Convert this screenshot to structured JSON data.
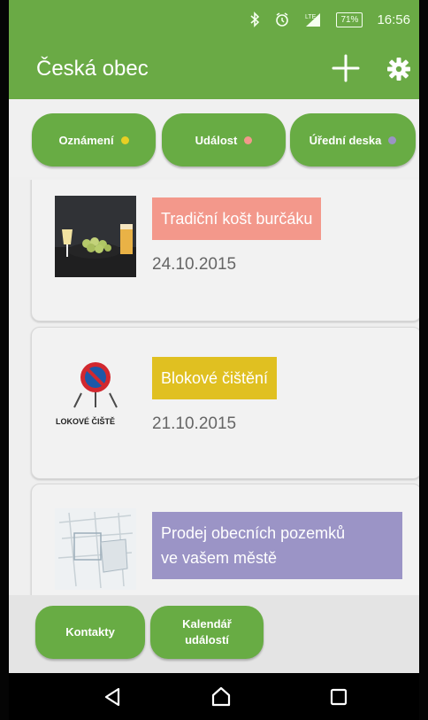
{
  "statusbar": {
    "icons": [
      "bluetooth-icon",
      "alarm-icon",
      "signal-icon",
      "battery-icon"
    ],
    "battery_label": "71%",
    "time": "16:56"
  },
  "appbar": {
    "title": "Česká obec",
    "actions": [
      "add-icon",
      "gear-icon"
    ]
  },
  "filters": [
    {
      "label": "Oznámení",
      "dot_color": "#e8cf24"
    },
    {
      "label": "Událost",
      "dot_color": "#f3988b"
    },
    {
      "label": "Úřední deska",
      "dot_color": "#9a94c4"
    }
  ],
  "items": [
    {
      "title": "Tradiční košt burčáku",
      "date": "24.10.2015",
      "tag_color": "#f3988b",
      "image": "wine-tasting-photo"
    },
    {
      "title": "Blokové čištění",
      "date": "21.10.2015",
      "tag_color": "#e0c021",
      "image": "no-parking-sign",
      "image_caption": "LOKOVÉ ČIŠTĚ"
    },
    {
      "title": "Prodej obecních pozemků ve vašem městě",
      "title_line1": "Prodej obecních pozemků",
      "title_line2": "ve vašem městě",
      "tag_color": "#9b94c6",
      "image": "land-map-photo"
    }
  ],
  "bottom": {
    "contacts_label": "Kontakty",
    "calendar_line1": "Kalendář",
    "calendar_line2": "událostí"
  },
  "navbar": {
    "icons": [
      "back-icon",
      "home-icon",
      "recent-apps-icon"
    ]
  },
  "colors": {
    "brand_green": "#6aaa45",
    "button_green": "#68ac44",
    "background": "#efefef"
  }
}
